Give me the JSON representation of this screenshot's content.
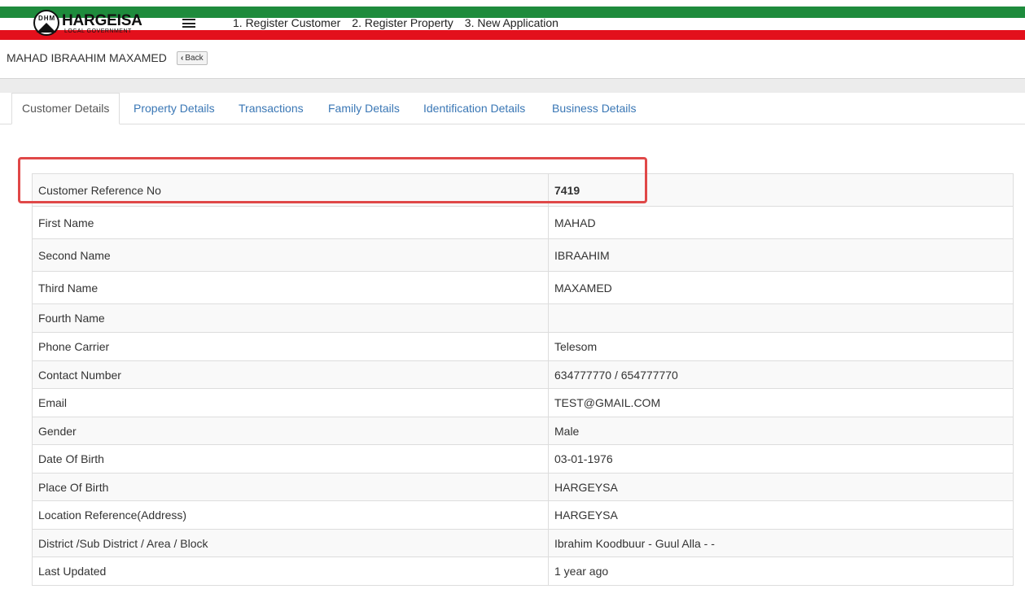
{
  "brand": {
    "title": "HARGEISA",
    "subtitle": "LOCAL GOVERNMENT",
    "emblem_letters": "DHM"
  },
  "colors": {
    "flag_green": "#1e8b3c",
    "flag_red": "#e3101c",
    "link_blue": "#3a77b5",
    "highlight_red": "#e04848"
  },
  "nav": {
    "menu_icon": "hamburger-menu-icon",
    "links": [
      "1. Register Customer",
      "2. Register Property",
      "3. New Application"
    ]
  },
  "header": {
    "title": "MAHAD IBRAAHIM MAXAMED",
    "back_label": "Back",
    "back_icon": "chevron-left-icon"
  },
  "tabs": [
    {
      "label": "Customer Details",
      "active": true
    },
    {
      "label": "Property Details",
      "active": false
    },
    {
      "label": "Transactions",
      "active": false
    },
    {
      "label": "Family Details",
      "active": false
    },
    {
      "label": "Identification Details",
      "active": false
    },
    {
      "label": "Business Details",
      "active": false
    }
  ],
  "details": [
    {
      "label": "Customer Reference No",
      "value": "7419",
      "highlighted": true
    },
    {
      "label": "First Name",
      "value": "MAHAD"
    },
    {
      "label": "Second Name",
      "value": "IBRAAHIM"
    },
    {
      "label": "Third Name",
      "value": "MAXAMED"
    },
    {
      "label": "Fourth Name",
      "value": ""
    },
    {
      "label": "Phone Carrier",
      "value": "Telesom"
    },
    {
      "label": "Contact Number",
      "value": "634777770 / 654777770"
    },
    {
      "label": "Email",
      "value": "TEST@GMAIL.COM"
    },
    {
      "label": "Gender",
      "value": "Male"
    },
    {
      "label": "Date Of Birth",
      "value": "03-01-1976"
    },
    {
      "label": "Place Of Birth",
      "value": "HARGEYSA"
    },
    {
      "label": "Location Reference(Address)",
      "value": "HARGEYSA"
    },
    {
      "label": "District /Sub District / Area / Block",
      "value": "Ibrahim Koodbuur - Guul Alla - -"
    },
    {
      "label": "Last Updated",
      "value": "1 year ago"
    }
  ]
}
